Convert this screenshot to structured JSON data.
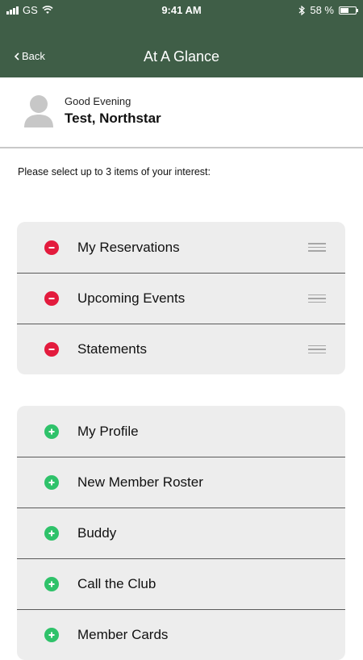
{
  "status_bar": {
    "carrier": "GS",
    "time": "9:41 AM",
    "battery_percent": "58 %",
    "battery_level": 0.58
  },
  "nav": {
    "back_label": "Back",
    "title": "At A Glance"
  },
  "greeting": {
    "salutation": "Good Evening",
    "name": "Test, Northstar"
  },
  "prompt": "Please select up to 3 items of your interest:",
  "selected_items": [
    {
      "label": "My Reservations"
    },
    {
      "label": "Upcoming Events"
    },
    {
      "label": "Statements"
    }
  ],
  "available_items": [
    {
      "label": "My Profile"
    },
    {
      "label": "New Member Roster"
    },
    {
      "label": "Buddy"
    },
    {
      "label": "Call the Club"
    },
    {
      "label": "Member Cards"
    }
  ],
  "colors": {
    "header_bg": "#3f5e47",
    "remove": "#e31b3d",
    "add": "#2fc26a",
    "card_bg": "#ededed"
  }
}
